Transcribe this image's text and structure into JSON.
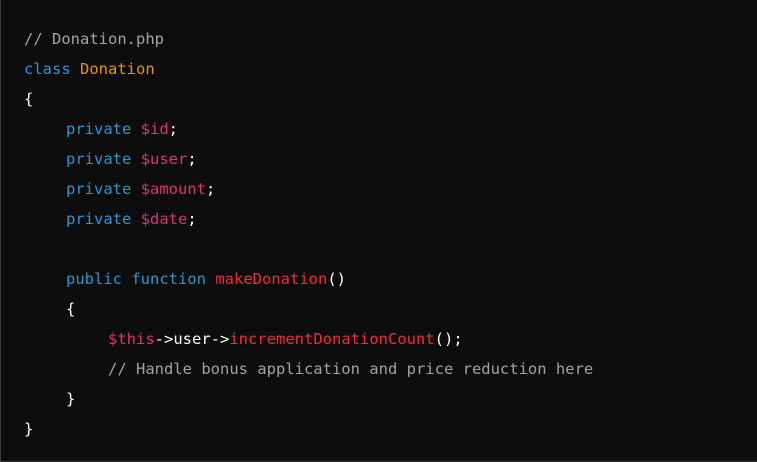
{
  "code": {
    "file_comment": "// Donation.php",
    "kw_class": "class",
    "class_name": "Donation",
    "open_brace": "{",
    "close_brace": "}",
    "kw_private": "private",
    "props": [
      "$id",
      "$user",
      "$amount",
      "$date"
    ],
    "semicolon": ";",
    "kw_public": "public",
    "kw_function": "function",
    "method_name": "makeDonation",
    "parens": "()",
    "this_var": "$this",
    "arrow": "->",
    "user_member": "user",
    "call_name": "incrementDonationCount",
    "call_tail": "();",
    "inner_comment": "// Handle bonus application and price reduction here"
  },
  "colors": {
    "background": "#0d0d0d",
    "comment": "#a3a3a3",
    "keyword": "#2e95d3",
    "class_name": "#e9950c",
    "variable": "#df3079",
    "function": "#f22c3d",
    "plain": "#ffffff"
  }
}
